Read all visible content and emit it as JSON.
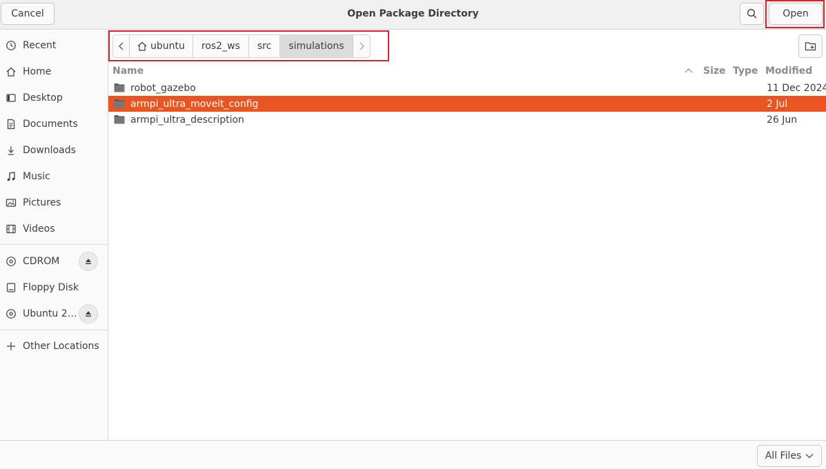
{
  "window": {
    "title": "Open Package Directory",
    "cancel_label": "Cancel",
    "open_label": "Open"
  },
  "sidebar": {
    "places": [
      {
        "label": "Recent",
        "icon": "clock-icon"
      },
      {
        "label": "Home",
        "icon": "home-icon"
      },
      {
        "label": "Desktop",
        "icon": "desktop-icon"
      },
      {
        "label": "Documents",
        "icon": "document-icon"
      },
      {
        "label": "Downloads",
        "icon": "download-icon"
      },
      {
        "label": "Music",
        "icon": "music-icon"
      },
      {
        "label": "Pictures",
        "icon": "picture-icon"
      },
      {
        "label": "Videos",
        "icon": "video-icon"
      }
    ],
    "devices": [
      {
        "label": "CDROM",
        "icon": "disc-icon"
      },
      {
        "label": "Floppy Disk",
        "icon": "drive-icon"
      },
      {
        "label": "Ubuntu 2…",
        "icon": "disc-icon"
      }
    ],
    "other_locations": "Other Locations"
  },
  "pathbar": {
    "crumbs": [
      "ubuntu",
      "ros2_ws",
      "src",
      "simulations"
    ],
    "active": "simulations"
  },
  "file_list": {
    "columns": {
      "name": "Name",
      "size": "Size",
      "type": "Type",
      "modified": "Modified"
    },
    "rows": [
      {
        "name": "robot_gazebo",
        "size": "",
        "type": "",
        "modified": "11 Dec 2024",
        "selected": false
      },
      {
        "name": "armpi_ultra_moveit_config",
        "size": "",
        "type": "",
        "modified": "2 Jul",
        "selected": true
      },
      {
        "name": "armpi_ultra_description",
        "size": "",
        "type": "",
        "modified": "26 Jun",
        "selected": false
      }
    ]
  },
  "filter": {
    "selected": "All Files"
  },
  "colors": {
    "accent": "#e95420",
    "highlight_box": "#d9222a"
  }
}
